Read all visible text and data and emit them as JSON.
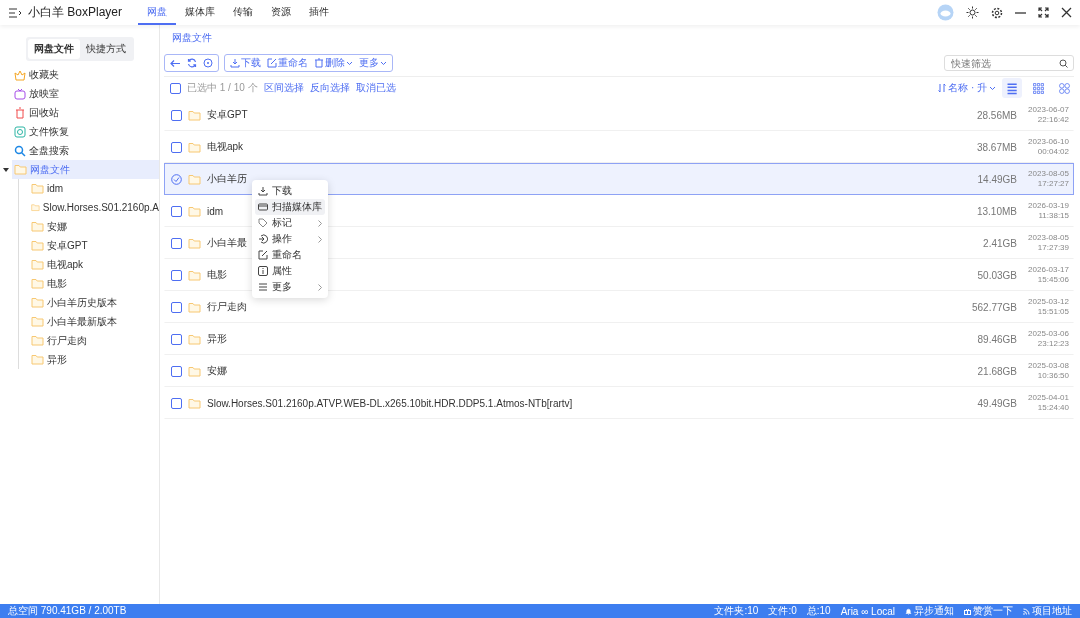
{
  "app": {
    "title": "小白羊 BoxPlayer"
  },
  "nav_tabs": [
    {
      "label": "网盘",
      "selected": true
    },
    {
      "label": "媒体库",
      "selected": false
    },
    {
      "label": "传输",
      "selected": false
    },
    {
      "label": "资源",
      "selected": false
    },
    {
      "label": "插件",
      "selected": false
    }
  ],
  "sidebar": {
    "tabs": [
      {
        "label": "网盘文件",
        "selected": true
      },
      {
        "label": "快捷方式",
        "selected": false
      }
    ],
    "items": [
      {
        "kind": "favorites",
        "label": "收藏夹",
        "selected": false
      },
      {
        "kind": "tv",
        "label": "放映室",
        "selected": false
      },
      {
        "kind": "trash",
        "label": "回收站",
        "selected": false
      },
      {
        "kind": "recover",
        "label": "文件恢复",
        "selected": false
      },
      {
        "kind": "search",
        "label": "全盘搜索",
        "selected": false
      },
      {
        "kind": "folder",
        "label": "网盘文件",
        "selected": true,
        "expanded": true,
        "children": [
          {
            "label": "idm",
            "selected": false
          },
          {
            "label": "Slow.Horses.S01.2160p.A",
            "selected": false
          },
          {
            "label": "安娜",
            "selected": false
          },
          {
            "label": "安卓GPT",
            "selected": false
          },
          {
            "label": "电视apk",
            "selected": false
          },
          {
            "label": "电影",
            "selected": false
          },
          {
            "label": "小白羊历史版本",
            "selected": false
          },
          {
            "label": "小白羊最新版本",
            "selected": false
          },
          {
            "label": "行尸走肉",
            "selected": false
          },
          {
            "label": "异形",
            "selected": false
          }
        ]
      }
    ]
  },
  "breadcrumb": "网盘文件",
  "toolbar": {
    "actions": [
      {
        "label": "下载",
        "kind": "download",
        "dropdown": false
      },
      {
        "label": "重命名",
        "kind": "rename",
        "dropdown": false
      },
      {
        "label": "删除",
        "kind": "delete",
        "dropdown": true
      },
      {
        "label": "更多",
        "kind": "none",
        "dropdown": true
      }
    ],
    "filter": {
      "placeholder": "快速筛选"
    }
  },
  "selection_bar": {
    "checked": false,
    "count": "已选中 1 / 10 个",
    "links": [
      "区间选择",
      "反向选择",
      "取消已选"
    ],
    "sort": "名称 · 升"
  },
  "view_modes": [
    {
      "kind": "list",
      "selected": true
    },
    {
      "kind": "grid",
      "selected": false
    },
    {
      "kind": "tiles",
      "selected": false
    }
  ],
  "files": [
    {
      "name": "安卓GPT",
      "size": "28.56MB",
      "date": "2023-06-07",
      "time": "22:16:42",
      "selected": false
    },
    {
      "name": "电视apk",
      "size": "38.67MB",
      "date": "2023-06-10",
      "time": "00:04:02",
      "selected": false
    },
    {
      "name": "小白羊历",
      "size": "14.49GB",
      "date": "2023-08-05",
      "time": "17:27:27",
      "selected": true
    },
    {
      "name": "idm",
      "size": "13.10MB",
      "date": "2026-03-19",
      "time": "11:38:15",
      "selected": false
    },
    {
      "name": "小白羊最",
      "size": "2.41GB",
      "date": "2023-08-05",
      "time": "17:27:39",
      "selected": false
    },
    {
      "name": "电影",
      "size": "50.03GB",
      "date": "2026-03-17",
      "time": "15:45:06",
      "selected": false
    },
    {
      "name": "行尸走肉",
      "size": "562.77GB",
      "date": "2025-03-12",
      "time": "15:51:05",
      "selected": false
    },
    {
      "name": "异形",
      "size": "89.46GB",
      "date": "2025-03-06",
      "time": "23:12:23",
      "selected": false
    },
    {
      "name": "安娜",
      "size": "21.68GB",
      "date": "2025-03-08",
      "time": "10:36:50",
      "selected": false
    },
    {
      "name": "Slow.Horses.S01.2160p.ATVP.WEB-DL.x265.10bit.HDR.DDP5.1.Atmos-NTb[rartv]",
      "size": "49.49GB",
      "date": "2025-04-01",
      "time": "15:24:40",
      "selected": false
    }
  ],
  "context_menu": [
    {
      "kind": "download",
      "label": "下载",
      "submenu": false,
      "highlighted": false
    },
    {
      "kind": "scan",
      "label": "扫描媒体库",
      "submenu": false,
      "highlighted": true
    },
    {
      "kind": "tag",
      "label": "标记",
      "submenu": true,
      "highlighted": false
    },
    {
      "kind": "operate",
      "label": "操作",
      "submenu": true,
      "highlighted": false
    },
    {
      "kind": "rename",
      "label": "重命名",
      "submenu": false,
      "highlighted": false
    },
    {
      "kind": "info",
      "label": "属性",
      "submenu": false,
      "highlighted": false
    },
    {
      "kind": "more",
      "label": "更多",
      "submenu": true,
      "highlighted": false
    }
  ],
  "status_bar": {
    "space": "总空间 790.41GB / 2.00TB",
    "folders": "文件夹:10",
    "files": "文件:0",
    "total": "总:10",
    "aria": "Aria ∞ Local",
    "notify": "异步通知",
    "donate": "赞赏一下",
    "project": "项目地址"
  }
}
